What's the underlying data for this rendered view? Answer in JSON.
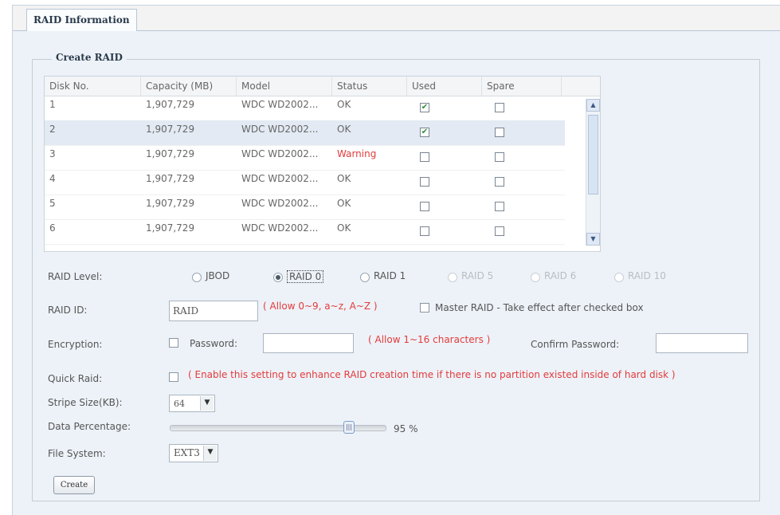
{
  "tab": {
    "label": "RAID Information"
  },
  "section": {
    "legend": "Create RAID"
  },
  "table": {
    "columns": [
      "Disk No.",
      "Capacity (MB)",
      "Model",
      "Status",
      "Used",
      "Spare"
    ],
    "rows": [
      {
        "disk": "1",
        "capacity": "1,907,729",
        "model": "WDC WD2002...",
        "status": "OK",
        "used": true,
        "spare": false,
        "selected": false,
        "warning": false
      },
      {
        "disk": "2",
        "capacity": "1,907,729",
        "model": "WDC WD2002...",
        "status": "OK",
        "used": true,
        "spare": false,
        "selected": true,
        "warning": false
      },
      {
        "disk": "3",
        "capacity": "1,907,729",
        "model": "WDC WD2002...",
        "status": "Warning",
        "used": false,
        "spare": false,
        "selected": false,
        "warning": true
      },
      {
        "disk": "4",
        "capacity": "1,907,729",
        "model": "WDC WD2002...",
        "status": "OK",
        "used": false,
        "spare": false,
        "selected": false,
        "warning": false
      },
      {
        "disk": "5",
        "capacity": "1,907,729",
        "model": "WDC WD2002...",
        "status": "OK",
        "used": false,
        "spare": false,
        "selected": false,
        "warning": false
      },
      {
        "disk": "6",
        "capacity": "1,907,729",
        "model": "WDC WD2002...",
        "status": "OK",
        "used": false,
        "spare": false,
        "selected": false,
        "warning": false
      }
    ]
  },
  "raid_level": {
    "label": "RAID Level:",
    "options": [
      {
        "label": "JBOD",
        "checked": false,
        "disabled": false
      },
      {
        "label": "RAID 0",
        "checked": true,
        "disabled": false
      },
      {
        "label": "RAID 1",
        "checked": false,
        "disabled": false
      },
      {
        "label": "RAID 5",
        "checked": false,
        "disabled": true
      },
      {
        "label": "RAID 6",
        "checked": false,
        "disabled": true
      },
      {
        "label": "RAID 10",
        "checked": false,
        "disabled": true
      }
    ]
  },
  "raid_id": {
    "label": "RAID ID:",
    "value": "RAID",
    "hint": "( Allow 0~9, a~z, A~Z )",
    "master_label": "Master RAID - Take effect after checked box",
    "master_checked": false
  },
  "encryption": {
    "label": "Encryption:",
    "checked": false,
    "password_label": "Password:",
    "password_value": "",
    "hint": "( Allow 1~16 characters )",
    "confirm_label": "Confirm Password:",
    "confirm_value": ""
  },
  "quick_raid": {
    "label": "Quick Raid:",
    "checked": false,
    "hint": "( Enable this setting to enhance RAID creation time if there is no partition existed inside of hard disk )"
  },
  "stripe_size": {
    "label": "Stripe Size(KB):",
    "value": "64"
  },
  "data_percentage": {
    "label": "Data Percentage:",
    "value": 95,
    "display": "95 %"
  },
  "file_system": {
    "label": "File System:",
    "value": "EXT3"
  },
  "create_button": "Create",
  "icons": {
    "scroll_up": "chevron-up-icon",
    "scroll_down": "chevron-down-icon",
    "dropdown": "chevron-down-icon",
    "check": "checkmark-icon"
  }
}
